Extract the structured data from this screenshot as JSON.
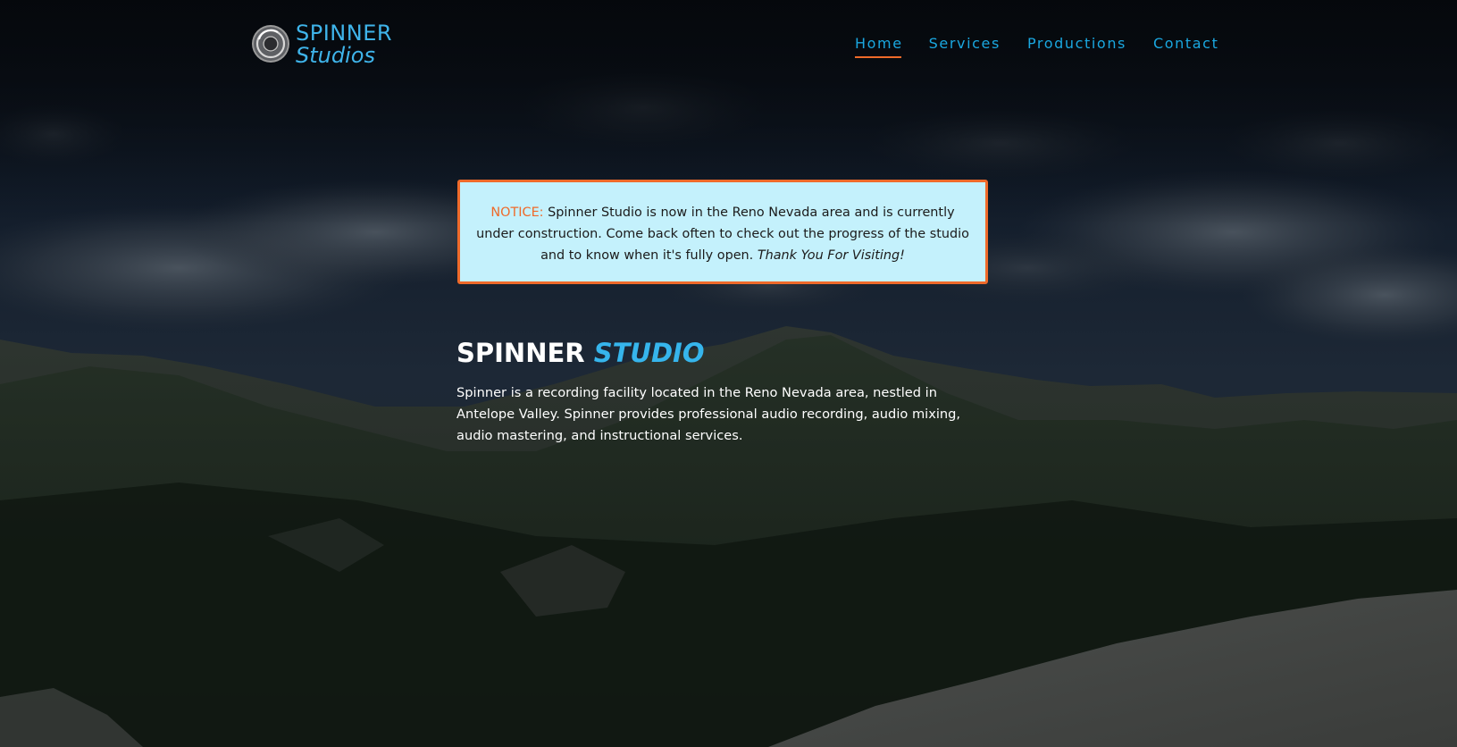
{
  "logo": {
    "line1": "SPINNER",
    "line2": "Studios",
    "mark_icon": "spinner-record-icon",
    "color": "#3fb4ea"
  },
  "nav": {
    "items": [
      {
        "label": "Home",
        "active": true
      },
      {
        "label": "Services",
        "active": false
      },
      {
        "label": "Productions",
        "active": false
      },
      {
        "label": "Contact",
        "active": false
      }
    ],
    "link_color": "#1aa7e0",
    "active_underline_color": "#ef6a2a"
  },
  "notice": {
    "label": "NOTICE:",
    "text": " Spinner Studio is now in the Reno Nevada area and is currently under construction. Come back often to check out the progress of the studio and to know when it's fully open. ",
    "closing": "Thank You For Visiting!",
    "background_color": "#c4f1fc",
    "border_color": "#ef6a2a"
  },
  "hero": {
    "title_main": "SPINNER",
    "title_accent": "STUDIO",
    "description": "Spinner is a recording facility located in the Reno Nevada area, nestled in Antelope Valley. Spinner provides professional audio recording, audio mixing, audio mastering, and instructional services.",
    "accent_color": "#36b5ec"
  }
}
